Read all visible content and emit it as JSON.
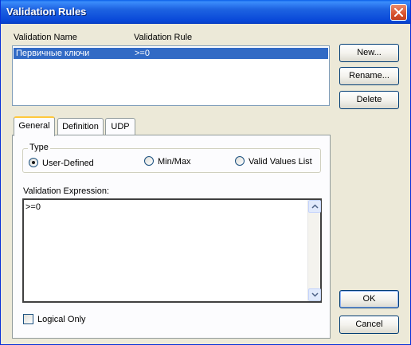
{
  "window": {
    "title": "Validation Rules"
  },
  "list": {
    "col_name": "Validation Name",
    "col_rule": "Validation Rule",
    "rows": [
      {
        "name": "Первичные ключи",
        "rule": ">=0"
      }
    ]
  },
  "buttons": {
    "new": "New...",
    "rename": "Rename...",
    "delete": "Delete",
    "ok": "OK",
    "cancel": "Cancel"
  },
  "tabs": [
    "General",
    "Definition",
    "UDP"
  ],
  "active_tab": "General",
  "type_group": {
    "title": "Type",
    "options": [
      "User-Defined",
      "Min/Max",
      "Valid Values List"
    ],
    "selected": "User-Defined"
  },
  "expression": {
    "label": "Validation Expression:",
    "value": ">=0"
  },
  "logical_only": {
    "label": "Logical Only",
    "checked": false
  },
  "colors": {
    "titlebar": "#0847d8",
    "selection": "#316ac5",
    "dialog_bg": "#ece9d8"
  },
  "icons": {
    "close": "close-icon",
    "scroll_up": "chevron-up-icon",
    "scroll_down": "chevron-down-icon"
  }
}
